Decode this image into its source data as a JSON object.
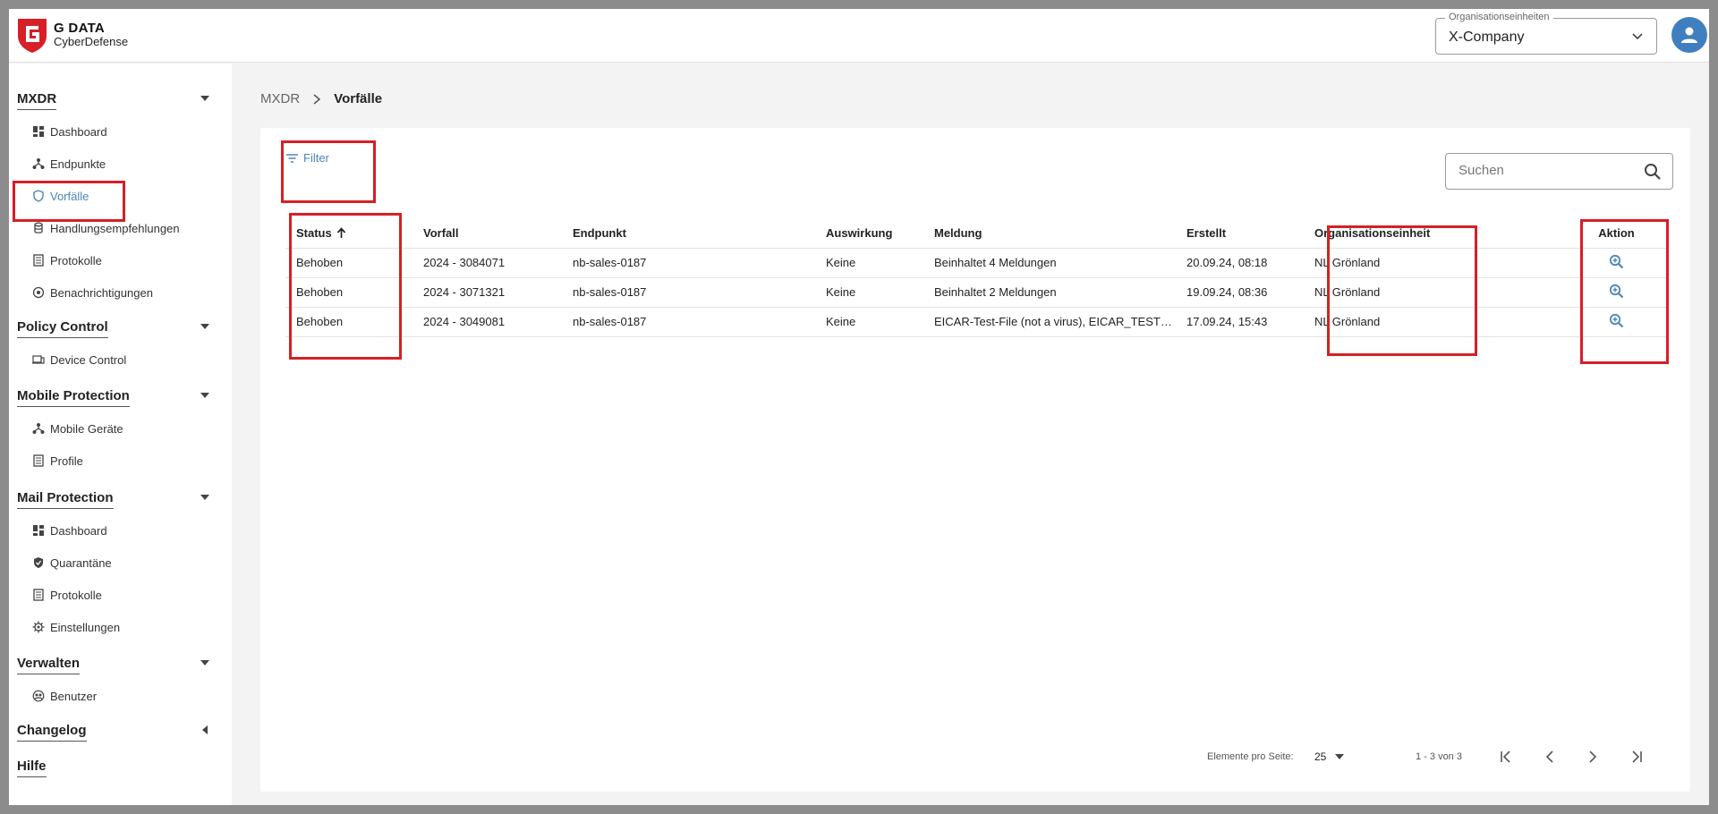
{
  "header": {
    "logo_line1": "G DATA",
    "logo_line2": "CyberDefense",
    "org_select": {
      "legend": "Organisationseinheiten",
      "value": "X-Company"
    }
  },
  "sidebar": {
    "sections": [
      {
        "title": "MXDR",
        "items": [
          "Dashboard",
          "Endpunkte",
          "Vorfälle",
          "Handlungsempfehlungen",
          "Protokolle",
          "Benachrichtigungen"
        ]
      },
      {
        "title": "Policy Control",
        "items": [
          "Device Control"
        ]
      },
      {
        "title": "Mobile Protection",
        "items": [
          "Mobile Geräte",
          "Profile"
        ]
      },
      {
        "title": "Mail Protection",
        "items": [
          "Dashboard",
          "Quarantäne",
          "Protokolle",
          "Einstellungen"
        ]
      },
      {
        "title": "Verwalten",
        "items": [
          "Benutzer"
        ]
      },
      {
        "title": "Changelog",
        "items": []
      },
      {
        "title": "Hilfe",
        "items": []
      }
    ]
  },
  "breadcrumb": {
    "root": "MXDR",
    "current": "Vorfälle"
  },
  "toolbar": {
    "filter_label": "Filter",
    "search_placeholder": "Suchen"
  },
  "table": {
    "headers": [
      "Status",
      "Vorfall",
      "Endpunkt",
      "Auswirkung",
      "Meldung",
      "Erstellt",
      "Organisationseinheit",
      "Aktion"
    ],
    "rows": [
      [
        "Behoben",
        "2024 - 3084071",
        "nb-sales-0187",
        "Keine",
        "Beinhaltet 4 Meldungen",
        "20.09.24, 08:18",
        "NL Grönland"
      ],
      [
        "Behoben",
        "2024 - 3071321",
        "nb-sales-0187",
        "Keine",
        "Beinhaltet 2 Meldungen",
        "19.09.24, 08:36",
        "NL Grönland"
      ],
      [
        "Behoben",
        "2024 - 3049081",
        "nb-sales-0187",
        "Keine",
        "EICAR-Test-File (not a virus), EICAR_TEST_...",
        "17.09.24, 15:43",
        "NL Grönland"
      ]
    ]
  },
  "paginator": {
    "label": "Elemente pro Seite:",
    "page_size": "25",
    "range": "1 - 3 von 3"
  },
  "colors": {
    "accent": "#4d86b5",
    "highlight": "#d61f26",
    "brand_red": "#d61f26"
  }
}
